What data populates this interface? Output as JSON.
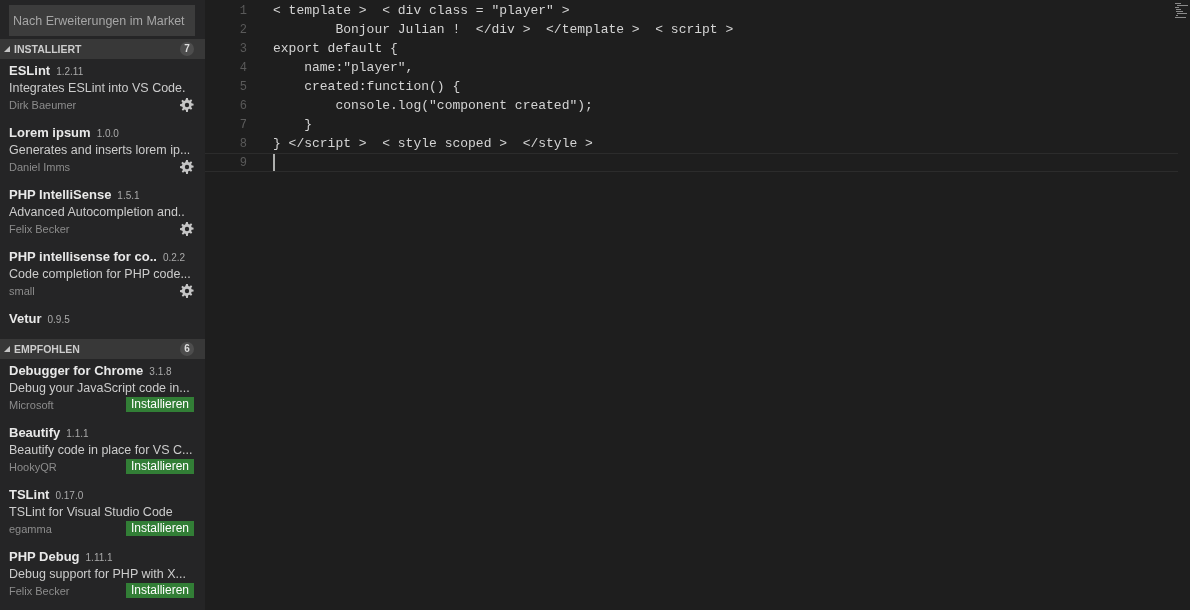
{
  "search": {
    "placeholder": "Nach Erweiterungen im Market"
  },
  "sections": [
    {
      "title": "INSTALLIERT",
      "count": "7",
      "expanded": true,
      "items": [
        {
          "name": "ESLint",
          "version": "1.2.11",
          "description": "Integrates ESLint into VS Code.",
          "author": "Dirk Baeumer",
          "kind": "installed"
        },
        {
          "name": "Lorem ipsum",
          "version": "1.0.0",
          "description": "Generates and inserts lorem ip...",
          "author": "Daniel Imms",
          "kind": "installed"
        },
        {
          "name": "PHP IntelliSense",
          "version": "1.5.1",
          "description": "Advanced Autocompletion and..",
          "author": "Felix Becker",
          "kind": "installed"
        },
        {
          "name": "PHP intellisense for co..",
          "version": "0.2.2",
          "description": "Code completion for PHP code...",
          "author": "small",
          "kind": "installed"
        },
        {
          "name": "Vetur",
          "version": "0.9.5",
          "kind": "installed"
        }
      ]
    },
    {
      "title": "EMPFOHLEN",
      "count": "6",
      "expanded": true,
      "items": [
        {
          "name": "Debugger for Chrome",
          "version": "3.1.8",
          "description": "Debug your JavaScript code in...",
          "author": "Microsoft",
          "kind": "recommended",
          "action": "Installieren"
        },
        {
          "name": "Beautify",
          "version": "1.1.1",
          "description": "Beautify code in place for VS C...",
          "author": "HookyQR",
          "kind": "recommended",
          "action": "Installieren"
        },
        {
          "name": "TSLint",
          "version": "0.17.0",
          "description": "TSLint for Visual Studio Code",
          "author": "egamma",
          "kind": "recommended",
          "action": "Installieren"
        },
        {
          "name": "PHP Debug",
          "version": "1.11.1",
          "description": "Debug support for PHP with X...",
          "author": "Felix Becker",
          "kind": "recommended",
          "action": "Installieren"
        }
      ]
    }
  ],
  "editor": {
    "lines": [
      {
        "number": "1",
        "text": "< template >  < div class = \"player\" >",
        "current": false
      },
      {
        "number": "2",
        "text": "        Bonjour Julian !  </div >  </template >  < script >",
        "current": false
      },
      {
        "number": "3",
        "text": "export default {",
        "current": false
      },
      {
        "number": "4",
        "text": "    name:\"player\",",
        "current": false
      },
      {
        "number": "5",
        "text": "    created:function() {",
        "current": false
      },
      {
        "number": "6",
        "text": "        console.log(\"component created\");",
        "current": false
      },
      {
        "number": "7",
        "text": "    }",
        "current": false
      },
      {
        "number": "8",
        "text": "} </script >  < style scoped >  </style >",
        "current": false
      },
      {
        "number": "9",
        "current": true
      }
    ]
  }
}
